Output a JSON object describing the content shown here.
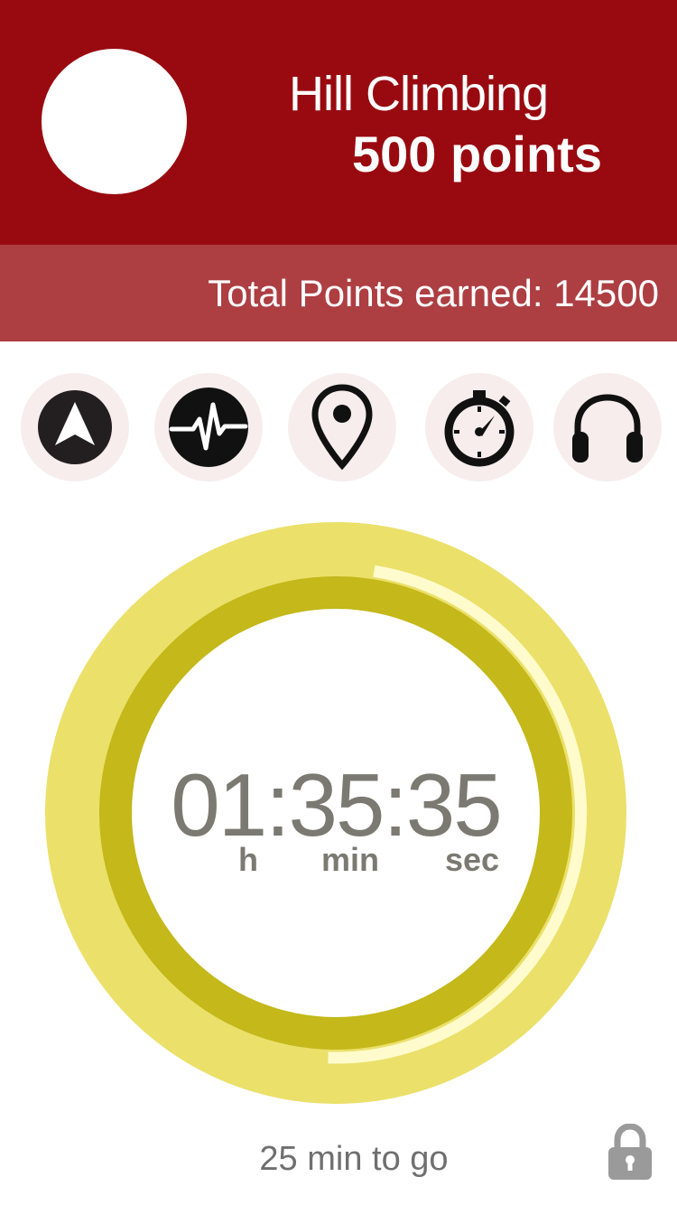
{
  "header": {
    "activity_title": "Hill Climbing",
    "activity_points": "500 points"
  },
  "totals": {
    "label": "Total Points earned: 14500"
  },
  "toolbar": {
    "icons": [
      "navigation-arrow-icon",
      "heart-rate-icon",
      "location-pin-icon",
      "stopwatch-icon",
      "headphones-icon"
    ]
  },
  "timer": {
    "time": "01:35:35",
    "hours_label": "h",
    "minutes_label": "min",
    "seconds_label": "sec",
    "progress_fraction": 0.48
  },
  "footer": {
    "remaining": "25 min to go",
    "lock_icon": "lock-icon"
  },
  "colors": {
    "header_bg": "#990a10",
    "totals_bg": "#ad3e42",
    "icon_circle_bg": "#f7eded",
    "ring_outer": "#ebe06a",
    "ring_inner": "#c4b81a",
    "progress_arc": "#fffbcc",
    "timer_text": "#7a7a72",
    "lock": "#9a9a9a"
  }
}
